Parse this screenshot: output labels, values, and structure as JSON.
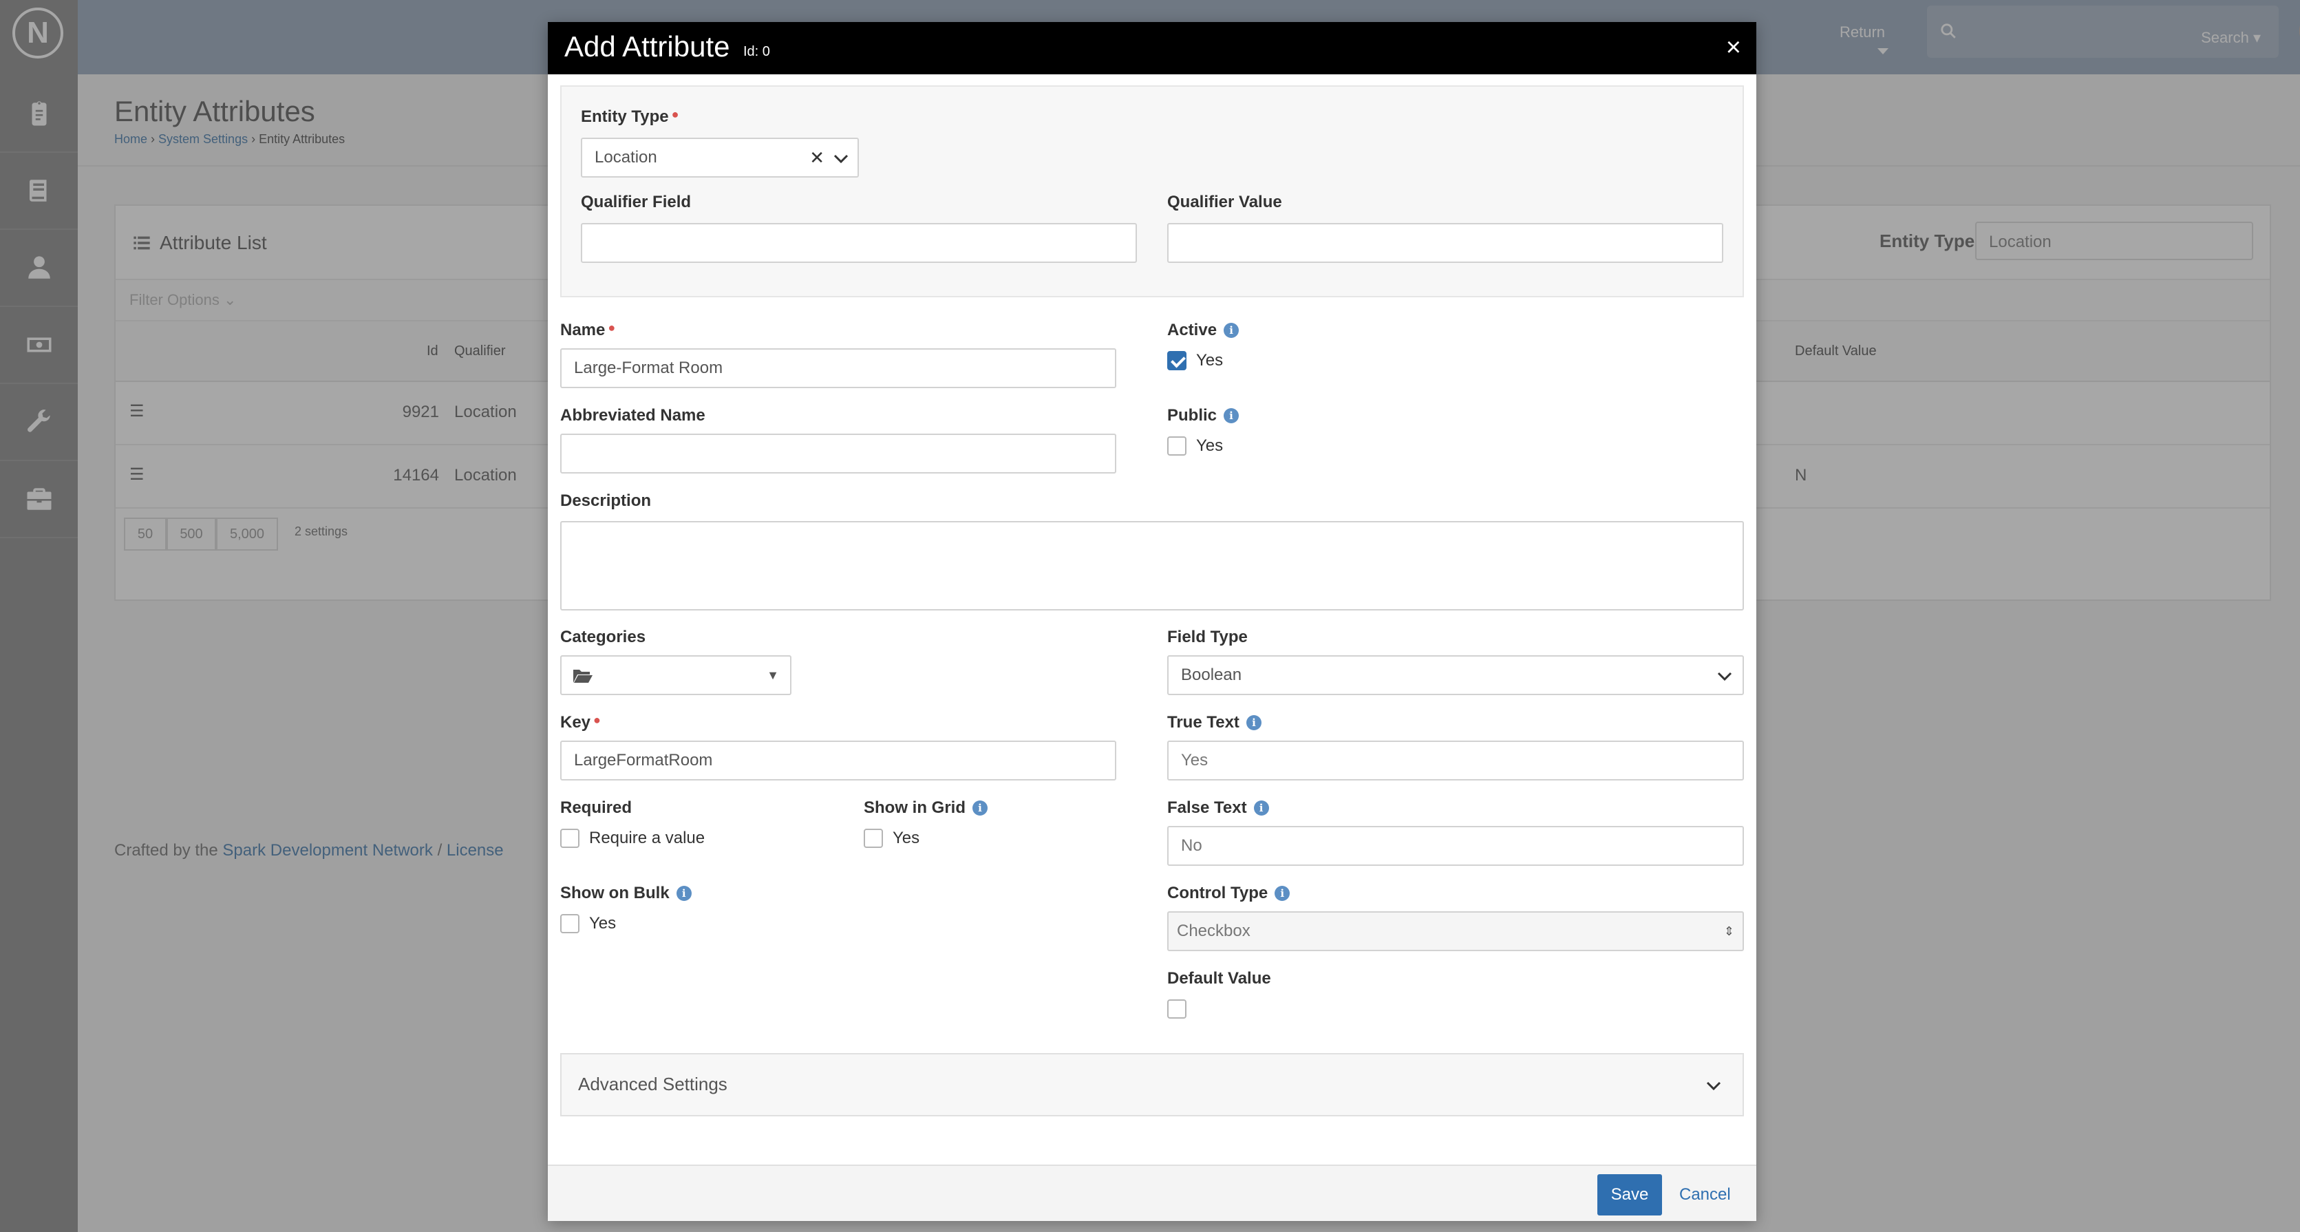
{
  "app": {
    "logo_letter": "N",
    "topbar": {
      "return_label": "Return",
      "search_label": "Search"
    }
  },
  "page": {
    "title": "Entity Attributes",
    "breadcrumb": [
      "Home",
      "System Settings",
      "Entity Attributes"
    ],
    "panel_title": "Attribute List",
    "filter_label": "Filter Options",
    "entity_type_label": "Entity Type",
    "entity_type_value": "Location",
    "columns": {
      "id": "Id",
      "qualifier": "Qualifier",
      "default_value": "Default Value"
    },
    "rows": [
      {
        "id": "9921",
        "qualifier": "Location",
        "default_value": ""
      },
      {
        "id": "14164",
        "qualifier": "Location",
        "default_value": "N"
      }
    ],
    "pager": [
      "50",
      "500",
      "5,000"
    ],
    "count_text": "2 settings",
    "footer": {
      "prefix": "Crafted by the",
      "network": "Spark Development Network",
      "sep": "/",
      "license": "License"
    }
  },
  "modal": {
    "title": "Add Attribute",
    "id_text": "Id: 0",
    "close": "×",
    "entity_type": {
      "label": "Entity Type",
      "value": "Location"
    },
    "qualifier_field": {
      "label": "Qualifier Field",
      "value": ""
    },
    "qualifier_value": {
      "label": "Qualifier Value",
      "value": ""
    },
    "name": {
      "label": "Name",
      "value": "Large-Format Room"
    },
    "abbreviated_name": {
      "label": "Abbreviated Name",
      "value": ""
    },
    "active": {
      "label": "Active",
      "option": "Yes",
      "checked": true
    },
    "public": {
      "label": "Public",
      "option": "Yes",
      "checked": false
    },
    "description": {
      "label": "Description",
      "value": ""
    },
    "categories": {
      "label": "Categories"
    },
    "field_type": {
      "label": "Field Type",
      "value": "Boolean"
    },
    "key": {
      "label": "Key",
      "value": "LargeFormatRoom"
    },
    "true_text": {
      "label": "True Text",
      "placeholder": "Yes"
    },
    "false_text": {
      "label": "False Text",
      "placeholder": "No"
    },
    "required": {
      "label": "Required",
      "option": "Require a value",
      "checked": false
    },
    "show_in_grid": {
      "label": "Show in Grid",
      "option": "Yes",
      "checked": false
    },
    "show_on_bulk": {
      "label": "Show on Bulk",
      "option": "Yes",
      "checked": false
    },
    "control_type": {
      "label": "Control Type",
      "value": "Checkbox"
    },
    "default_value": {
      "label": "Default Value",
      "checked": false
    },
    "advanced_settings": "Advanced Settings",
    "save": "Save",
    "cancel": "Cancel"
  }
}
